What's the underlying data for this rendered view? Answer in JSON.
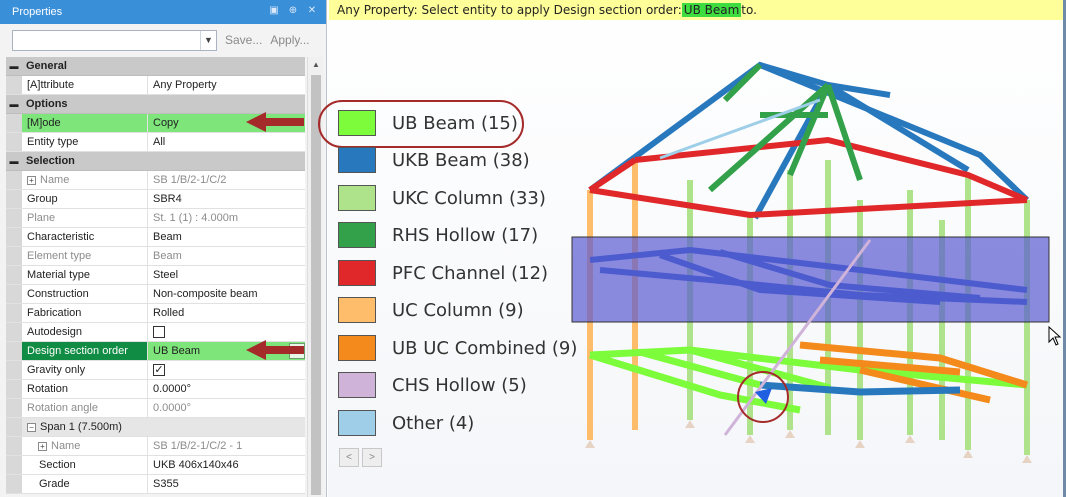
{
  "panel": {
    "title": "Properties",
    "title_buttons": [
      "▣",
      "⊕",
      "✕"
    ],
    "combo_value": "",
    "save_label": "Save...",
    "apply_label": "Apply..."
  },
  "grid": {
    "general": {
      "label": "General"
    },
    "attribute": {
      "name": "[A]ttribute",
      "value": "Any Property"
    },
    "options": {
      "label": "Options"
    },
    "mode": {
      "name": "[M]ode",
      "value": "Copy"
    },
    "entity_type": {
      "name": "Entity type",
      "value": "All"
    },
    "selection": {
      "label": "Selection"
    },
    "sel_name": {
      "name": "Name",
      "value": "SB 1/B/2-1/C/2"
    },
    "group": {
      "name": "Group",
      "value": "SBR4"
    },
    "plane": {
      "name": "Plane",
      "value": "St. 1 (1) : 4.000m"
    },
    "characteristic": {
      "name": "Characteristic",
      "value": "Beam"
    },
    "element_type": {
      "name": "Element type",
      "value": "Beam"
    },
    "material_type": {
      "name": "Material type",
      "value": "Steel"
    },
    "construction": {
      "name": "Construction",
      "value": "Non-composite beam"
    },
    "fabrication": {
      "name": "Fabrication",
      "value": "Rolled"
    },
    "autodesign": {
      "name": "Autodesign",
      "checked": false
    },
    "design_section_order": {
      "name": "Design section order",
      "value": "UB Beam"
    },
    "gravity_only": {
      "name": "Gravity only",
      "checked": true,
      "check_glyph": "✓"
    },
    "rotation": {
      "name": "Rotation",
      "value": "0.0000°"
    },
    "rotation_angle": {
      "name": "Rotation angle",
      "value": "0.0000°"
    },
    "span1": {
      "label": "Span 1 (7.500m)"
    },
    "span_name": {
      "name": "Name",
      "value": "SB 1/B/2-1/C/2 - 1"
    },
    "section": {
      "name": "Section",
      "value": "UKB 406x140x46"
    },
    "grade": {
      "name": "Grade",
      "value": "S355"
    }
  },
  "status": {
    "prefix": "Any Property: Select entity to apply Design section order: ",
    "highlight": "UB Beam",
    "suffix": " to."
  },
  "legend": [
    {
      "label": "UB Beam (15)",
      "color": "#7cfc3a"
    },
    {
      "label": "UKB Beam (38)",
      "color": "#2878be"
    },
    {
      "label": "UKC Column (33)",
      "color": "#aee38c"
    },
    {
      "label": "RHS Hollow (17)",
      "color": "#33a04a"
    },
    {
      "label": "PFC Channel (12)",
      "color": "#e0282a"
    },
    {
      "label": "UC Column (9)",
      "color": "#fdbd6b"
    },
    {
      "label": "UB UC Combined (9)",
      "color": "#f38a1b"
    },
    {
      "label": "CHS Hollow (5)",
      "color": "#cfb3d9"
    },
    {
      "label": "Other (4)",
      "color": "#9fcfe8"
    }
  ],
  "legend_nav": {
    "prev": "<",
    "next": ">"
  },
  "colors": {
    "annotation": "#a52a2a",
    "selection_box": "#5a5ad2",
    "accent": "#3a8fd9",
    "highlight_green": "#7de57a"
  }
}
